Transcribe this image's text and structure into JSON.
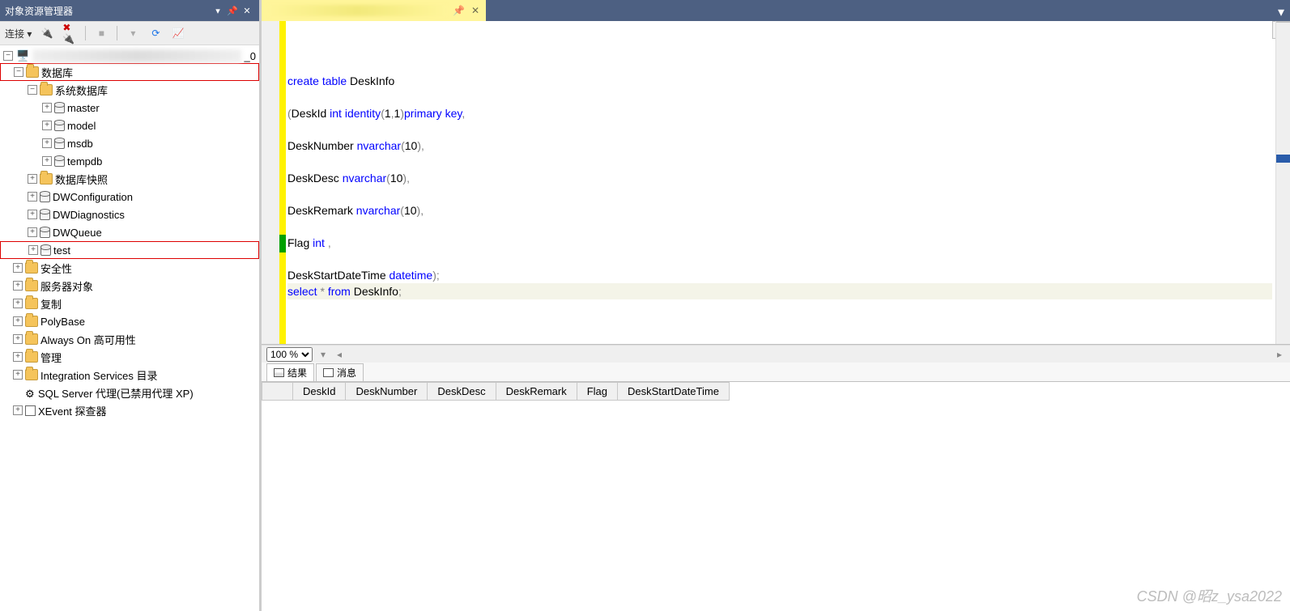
{
  "sidebar": {
    "title": "对象资源管理器",
    "connect_label": "连接",
    "server_suffix": "_0",
    "nodes": {
      "db_root": {
        "label": "数据库",
        "expanded": true,
        "redbox": true
      },
      "sysdb": {
        "label": "系统数据库",
        "expanded": true
      },
      "master": {
        "label": "master"
      },
      "model": {
        "label": "model"
      },
      "msdb": {
        "label": "msdb"
      },
      "tempdb": {
        "label": "tempdb"
      },
      "db_snapshot": {
        "label": "数据库快照"
      },
      "dwconfig": {
        "label": "DWConfiguration"
      },
      "dwdiag": {
        "label": "DWDiagnostics"
      },
      "dwqueue": {
        "label": "DWQueue"
      },
      "test": {
        "label": "test",
        "redbox": true
      },
      "security": {
        "label": "安全性"
      },
      "serverobj": {
        "label": "服务器对象"
      },
      "replication": {
        "label": "复制"
      },
      "polybase": {
        "label": "PolyBase"
      },
      "alwayson": {
        "label": "Always On 高可用性"
      },
      "management": {
        "label": "管理"
      },
      "int_services": {
        "label": "Integration Services 目录"
      },
      "sqlagent": {
        "label": "SQL Server 代理(已禁用代理 XP)"
      },
      "xevent": {
        "label": "XEvent 探查器"
      }
    }
  },
  "editor": {
    "zoom": "100 %",
    "code_tokens": [
      [
        {
          "t": "create",
          "c": "kw"
        },
        {
          "t": " ",
          "c": "txt"
        },
        {
          "t": "table",
          "c": "kw"
        },
        {
          "t": " DeskInfo",
          "c": "txt"
        }
      ],
      [],
      [
        {
          "t": "(",
          "c": "gray"
        },
        {
          "t": "DeskId ",
          "c": "txt"
        },
        {
          "t": "int",
          "c": "kw"
        },
        {
          "t": " ",
          "c": "txt"
        },
        {
          "t": "identity",
          "c": "kw"
        },
        {
          "t": "(",
          "c": "gray"
        },
        {
          "t": "1",
          "c": "txt"
        },
        {
          "t": ",",
          "c": "gray"
        },
        {
          "t": "1",
          "c": "txt"
        },
        {
          "t": ")",
          "c": "gray"
        },
        {
          "t": "primary",
          "c": "kw"
        },
        {
          "t": " ",
          "c": "txt"
        },
        {
          "t": "key",
          "c": "kw"
        },
        {
          "t": ",",
          "c": "gray"
        }
      ],
      [],
      [
        {
          "t": "DeskNumber ",
          "c": "txt"
        },
        {
          "t": "nvarchar",
          "c": "kw"
        },
        {
          "t": "(",
          "c": "gray"
        },
        {
          "t": "10",
          "c": "txt"
        },
        {
          "t": ")",
          "c": "gray"
        },
        {
          "t": ",",
          "c": "gray"
        }
      ],
      [],
      [
        {
          "t": "DeskDesc ",
          "c": "txt"
        },
        {
          "t": "nvarchar",
          "c": "kw"
        },
        {
          "t": "(",
          "c": "gray"
        },
        {
          "t": "10",
          "c": "txt"
        },
        {
          "t": ")",
          "c": "gray"
        },
        {
          "t": ",",
          "c": "gray"
        }
      ],
      [],
      [
        {
          "t": "DeskRemark ",
          "c": "txt"
        },
        {
          "t": "nvarchar",
          "c": "kw"
        },
        {
          "t": "(",
          "c": "gray"
        },
        {
          "t": "10",
          "c": "txt"
        },
        {
          "t": ")",
          "c": "gray"
        },
        {
          "t": ",",
          "c": "gray"
        }
      ],
      [],
      [
        {
          "t": "Flag ",
          "c": "txt"
        },
        {
          "t": "int",
          "c": "kw"
        },
        {
          "t": " ",
          "c": "txt"
        },
        {
          "t": ",",
          "c": "gray"
        }
      ],
      [],
      [
        {
          "t": "DeskStartDateTime ",
          "c": "txt"
        },
        {
          "t": "datetime",
          "c": "kw"
        },
        {
          "t": ")",
          "c": "gray"
        },
        {
          "t": ";",
          "c": "gray"
        }
      ],
      [
        {
          "t": "select",
          "c": "kw"
        },
        {
          "t": " ",
          "c": "txt"
        },
        {
          "t": "*",
          "c": "gray"
        },
        {
          "t": " ",
          "c": "txt"
        },
        {
          "t": "from",
          "c": "kw"
        },
        {
          "t": " DeskInfo",
          "c": "txt"
        },
        {
          "t": ";",
          "c": "gray"
        }
      ]
    ],
    "highlight_line_index": 13
  },
  "results": {
    "tabs": {
      "results": "结果",
      "messages": "消息"
    },
    "columns": [
      "DeskId",
      "DeskNumber",
      "DeskDesc",
      "DeskRemark",
      "Flag",
      "DeskStartDateTime"
    ]
  },
  "watermark": "CSDN @昭z_ysa2022"
}
